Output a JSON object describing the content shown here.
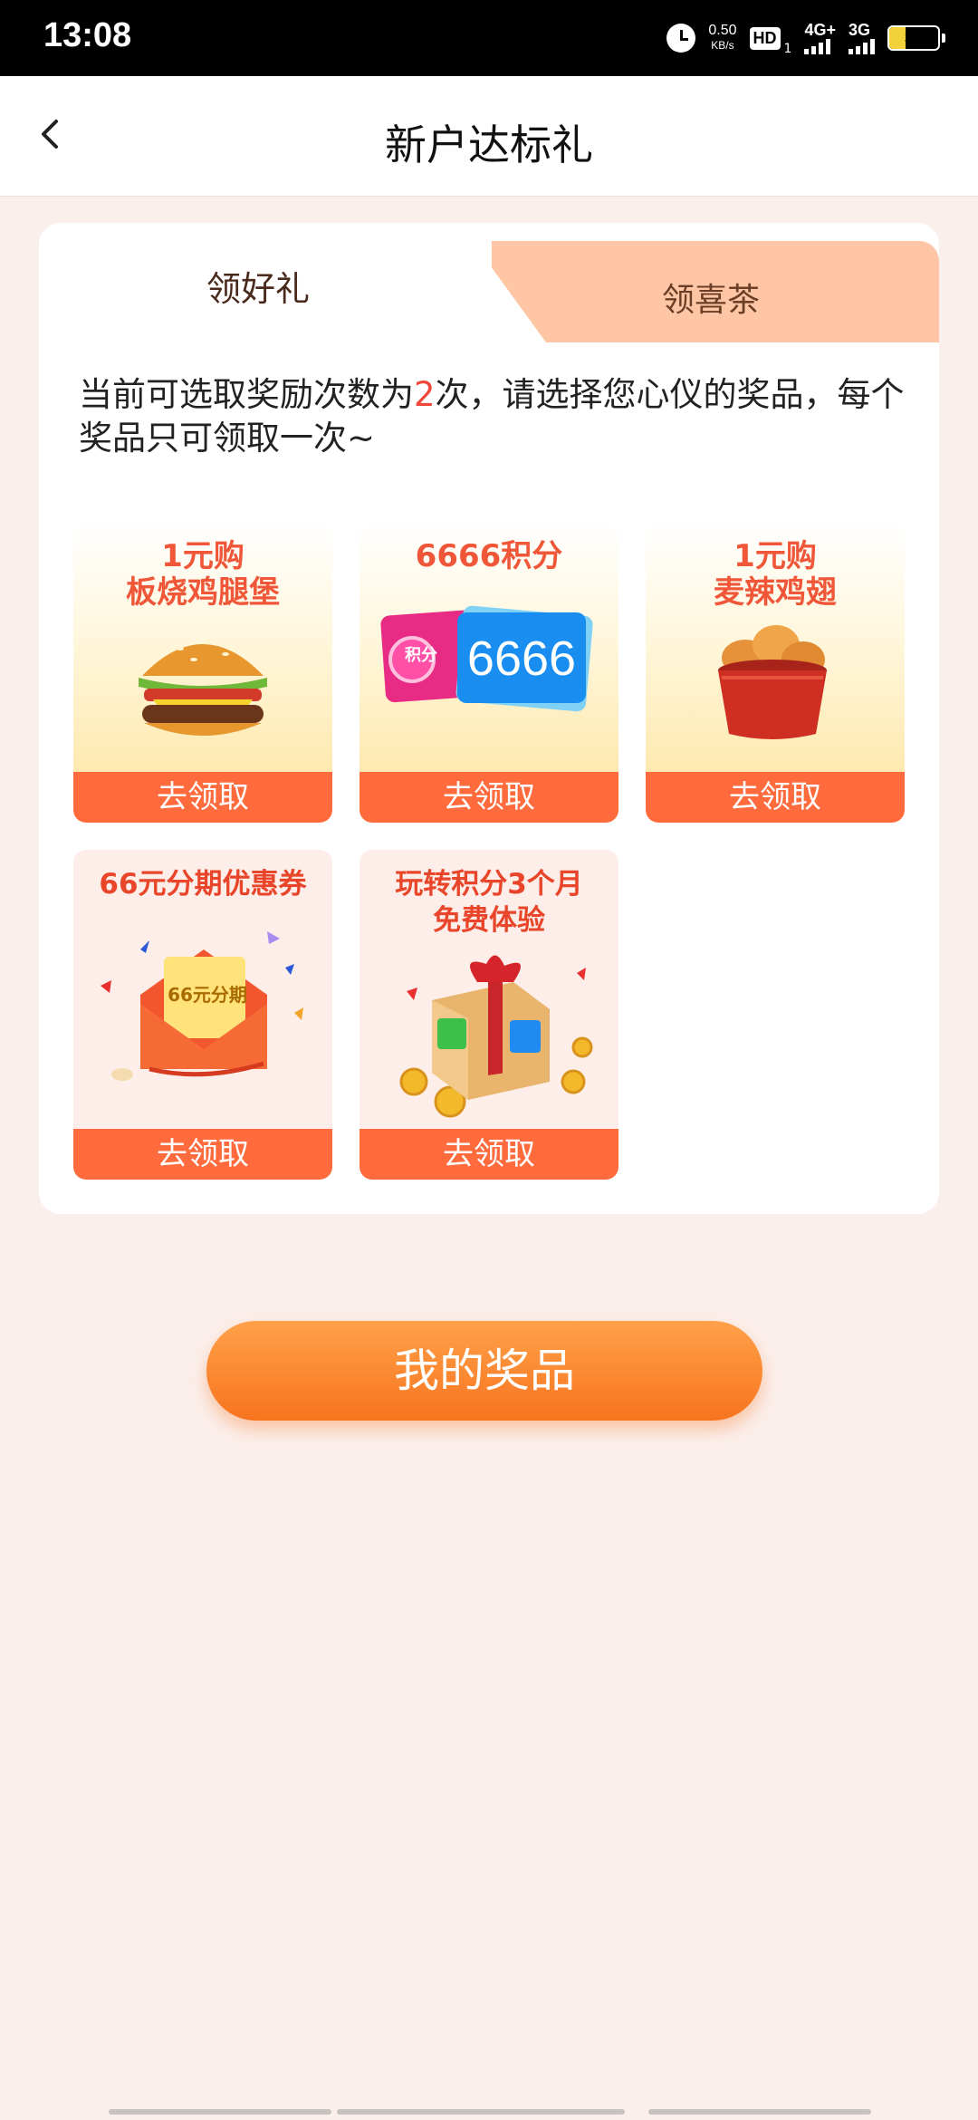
{
  "status_bar": {
    "time": "13:08",
    "net_speed_value": "0.50",
    "net_speed_unit": "KB/s",
    "hd_label": "HD",
    "hd_sub": "1",
    "signal1_label": "4G+",
    "signal2_label": "3G",
    "battery_level": "34"
  },
  "header": {
    "title": "新户达标礼"
  },
  "tabs": [
    {
      "label": "领好礼",
      "active": true
    },
    {
      "label": "领喜茶",
      "active": false
    }
  ],
  "description": {
    "prefix": "当前可选取奖励次数为",
    "count": "2",
    "suffix": "次，请选择您心仪的奖品，每个奖品只可领取一次~"
  },
  "prizes": [
    {
      "title_line1": "1元购",
      "title_line2": "板烧鸡腿堡",
      "button": "去领取"
    },
    {
      "title_line1": "6666积分",
      "title_line2": "",
      "art_value": "6666",
      "art_badge": "积分",
      "button": "去领取"
    },
    {
      "title_line1": "1元购",
      "title_line2": "麦辣鸡翅",
      "button": "去领取"
    },
    {
      "title_line1": "66元分期优惠券",
      "title_line2": "",
      "art_value": "66元分期",
      "button": "去领取"
    },
    {
      "title_line1": "玩转积分3个月",
      "title_line2": "免费体验",
      "art_coin": "积分",
      "button": "去领取"
    }
  ],
  "main_button": "我的奖品",
  "colors": {
    "accent": "#ff6b3d",
    "page_bg": "#fbefeb",
    "tab_inactive": "#ffc6a5",
    "count_red": "#f0473a"
  }
}
